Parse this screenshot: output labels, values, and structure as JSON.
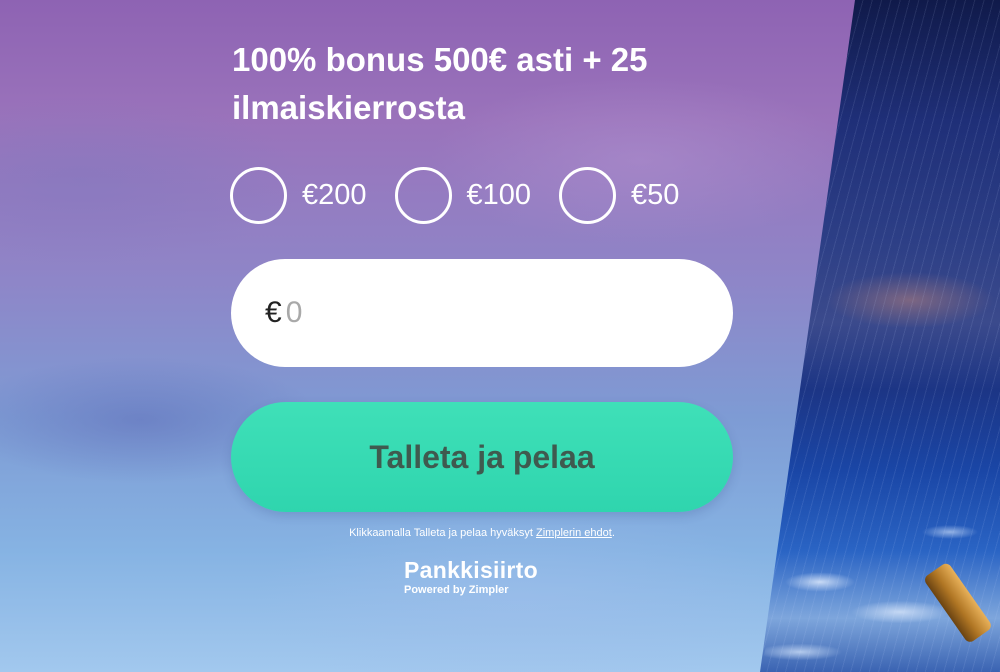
{
  "offer": {
    "headline": "100% bonus 500€ asti + 25 ilmaiskierrosta"
  },
  "amount_options": [
    {
      "label": "€200",
      "selected": false
    },
    {
      "label": "€100",
      "selected": false
    },
    {
      "label": "€50",
      "selected": false
    }
  ],
  "amount_input": {
    "currency": "€",
    "value": "",
    "placeholder": "0"
  },
  "deposit_button": {
    "label": "Talleta ja pelaa",
    "color": "#31d7af"
  },
  "terms": {
    "text_before": "Klikkaamalla Talleta ja pelaa hyväksyt ",
    "link_text": "Zimplerin ehdot",
    "text_after": "."
  },
  "provider": {
    "name": "Pankkisiirto",
    "powered_by": "Powered by Zimpler"
  },
  "background": {
    "theme": "stormy-sea",
    "decor_icon": "telescope-icon"
  }
}
